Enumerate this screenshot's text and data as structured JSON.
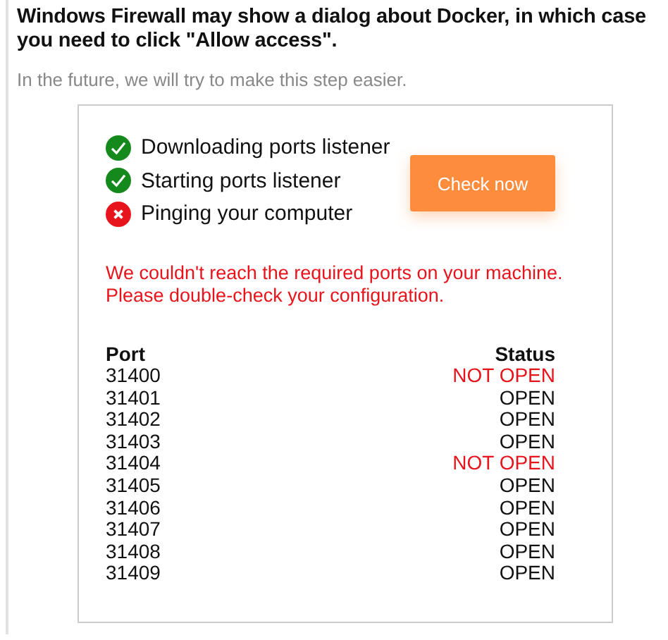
{
  "instructions": [
    "Windows Firewall may show a dialog about Docker, in which case",
    "you need to click \"Allow access\"."
  ],
  "note": "In the future, we will try to make this step easier.",
  "steps": [
    {
      "label": "Downloading ports listener",
      "done": true
    },
    {
      "label": "Starting ports listener",
      "done": true
    },
    {
      "label": "Pinging your computer",
      "done": false
    }
  ],
  "check_button": "Check now",
  "error_lines": [
    "We couldn't reach the required ports on your machine.",
    "Please double-check your configuration."
  ],
  "table": {
    "columns": [
      "Port",
      "Status"
    ],
    "rows": [
      {
        "port": "31400",
        "status": "NOT OPEN",
        "open": false
      },
      {
        "port": "31401",
        "status": "OPEN",
        "open": true
      },
      {
        "port": "31402",
        "status": "OPEN",
        "open": true
      },
      {
        "port": "31403",
        "status": "OPEN",
        "open": true
      },
      {
        "port": "31404",
        "status": "NOT OPEN",
        "open": false
      },
      {
        "port": "31405",
        "status": "OPEN",
        "open": true
      },
      {
        "port": "31406",
        "status": "OPEN",
        "open": true
      },
      {
        "port": "31407",
        "status": "OPEN",
        "open": true
      },
      {
        "port": "31408",
        "status": "OPEN",
        "open": true
      },
      {
        "port": "31409",
        "status": "OPEN",
        "open": true
      }
    ]
  }
}
